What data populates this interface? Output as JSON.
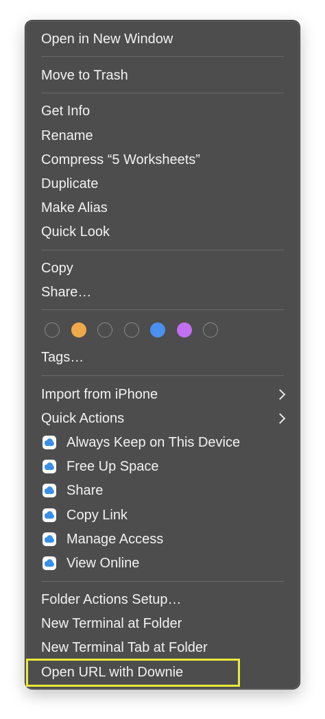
{
  "menu": {
    "items": [
      {
        "label": "Open in New Window"
      },
      {
        "label": "Move to Trash"
      },
      {
        "label": "Get Info"
      },
      {
        "label": "Rename"
      },
      {
        "label": "Compress “5 Worksheets”"
      },
      {
        "label": "Duplicate"
      },
      {
        "label": "Make Alias"
      },
      {
        "label": "Quick Look"
      },
      {
        "label": "Copy"
      },
      {
        "label": "Share…"
      },
      {
        "label": "Tags…"
      },
      {
        "label": "Import from iPhone"
      },
      {
        "label": "Quick Actions"
      },
      {
        "label": "Always Keep on This Device",
        "icon": "icloud-icon"
      },
      {
        "label": "Free Up Space",
        "icon": "icloud-icon"
      },
      {
        "label": "Share",
        "icon": "icloud-icon"
      },
      {
        "label": "Copy Link",
        "icon": "icloud-icon"
      },
      {
        "label": "Manage Access",
        "icon": "icloud-icon"
      },
      {
        "label": "View Online",
        "icon": "icloud-icon"
      },
      {
        "label": "Folder Actions Setup…"
      },
      {
        "label": "New Terminal at Folder"
      },
      {
        "label": "New Terminal Tab at Folder"
      },
      {
        "label": "Open URL with Downie"
      }
    ],
    "tag_colors": [
      "none",
      "#f0a94a",
      "none",
      "none",
      "#4a90f0",
      "#c070f0",
      "none"
    ],
    "highlight_color": "#eaea3a",
    "background": "#4d4d4d"
  }
}
